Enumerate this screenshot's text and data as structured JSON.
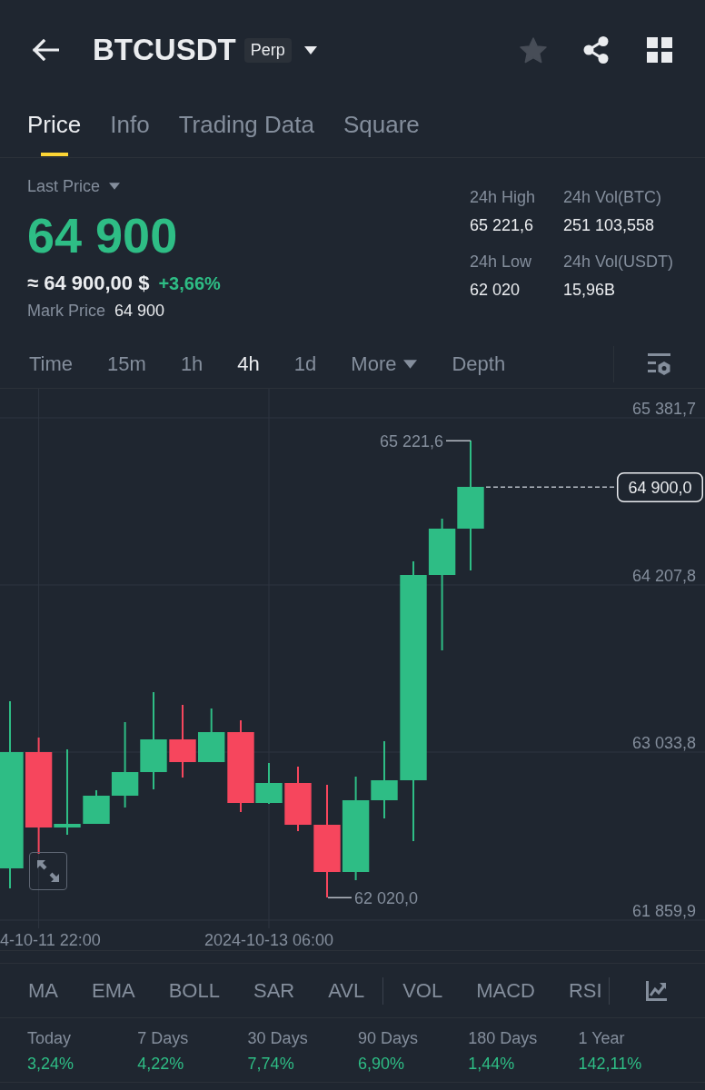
{
  "header": {
    "title": "BTCUSDT",
    "badge": "Perp",
    "favorite": false
  },
  "tabs": [
    {
      "label": "Price",
      "selected": true
    },
    {
      "label": "Info",
      "selected": false
    },
    {
      "label": "Trading Data",
      "selected": false
    },
    {
      "label": "Square",
      "selected": false
    }
  ],
  "price": {
    "selector": "Last Price",
    "last": "64 900",
    "approx": "≈ 64 900,00 $",
    "change": "+3,66%",
    "mark_label": "Mark Price",
    "mark_value": "64 900"
  },
  "stats": [
    {
      "label": "24h High",
      "value": "65 221,6"
    },
    {
      "label": "24h Vol(BTC)",
      "value": "251 103,558"
    },
    {
      "label": "24h Low",
      "value": "62 020"
    },
    {
      "label": "24h Vol(USDT)",
      "value": "15,96B"
    }
  ],
  "intervals": [
    {
      "label": "Time",
      "kind": "option",
      "selected": false
    },
    {
      "label": "15m",
      "kind": "option",
      "selected": false
    },
    {
      "label": "1h",
      "kind": "option",
      "selected": false
    },
    {
      "label": "4h",
      "kind": "option",
      "selected": true
    },
    {
      "label": "1d",
      "kind": "option",
      "selected": false
    },
    {
      "label": "More",
      "kind": "dropdown",
      "selected": false
    },
    {
      "label": "Depth",
      "kind": "option",
      "selected": false
    }
  ],
  "chart": {
    "price_labels": [
      "65 381,7",
      "64 207,8",
      "63 033,8",
      "61 859,9"
    ],
    "date_labels": [
      "4-10-11 22:00",
      "2024-10-13 06:00"
    ],
    "high_label": "65 221,6",
    "low_label": "62 020,0",
    "last_price_tag": "64 900,0"
  },
  "indicators": {
    "main": [
      {
        "label": "MA",
        "selected": false
      },
      {
        "label": "EMA",
        "selected": false
      },
      {
        "label": "BOLL",
        "selected": false
      },
      {
        "label": "SAR",
        "selected": false
      },
      {
        "label": "AVL",
        "selected": false
      }
    ],
    "sub": [
      {
        "label": "VOL",
        "selected": false
      },
      {
        "label": "MACD",
        "selected": false
      },
      {
        "label": "RSI",
        "selected": false
      }
    ]
  },
  "performance": [
    {
      "period": "Today",
      "value": "3,24%"
    },
    {
      "period": "7 Days",
      "value": "4,22%"
    },
    {
      "period": "30 Days",
      "value": "7,74%"
    },
    {
      "period": "90 Days",
      "value": "6,90%"
    },
    {
      "period": "180 Days",
      "value": "1,44%"
    },
    {
      "period": "1 Year",
      "value": "142,11%"
    }
  ]
}
